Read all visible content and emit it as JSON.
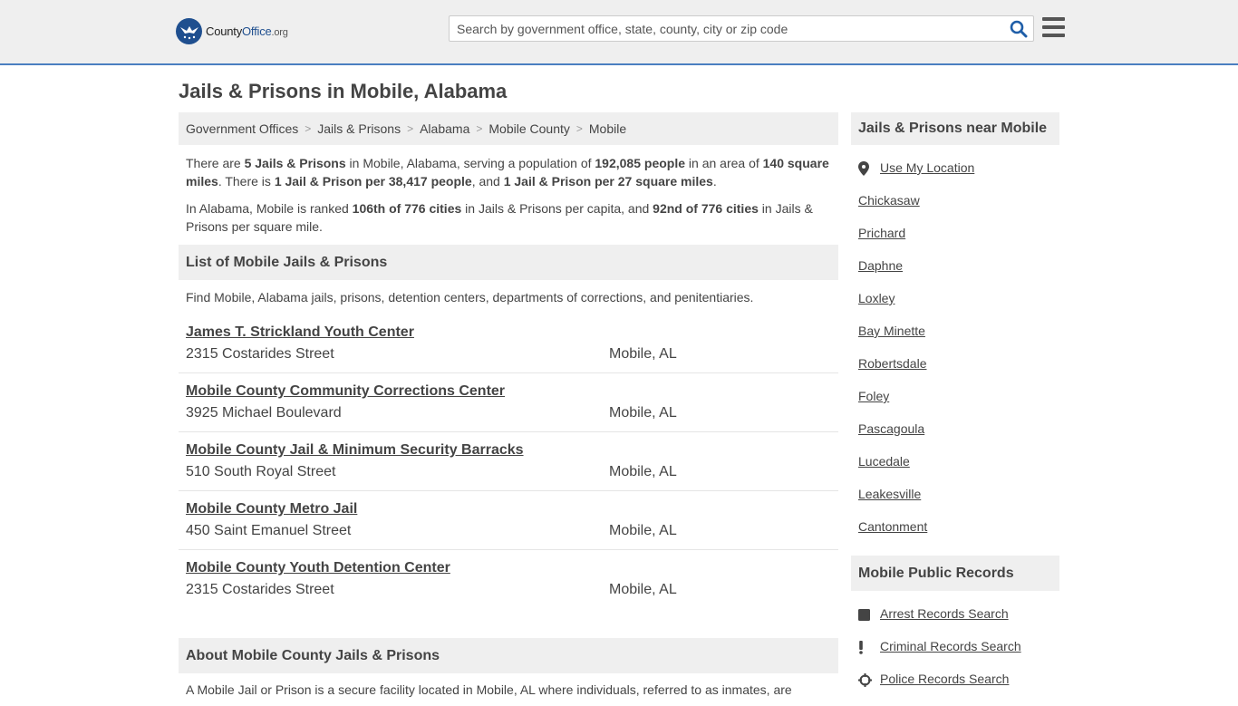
{
  "header": {
    "logo": {
      "name_part1": "County",
      "name_part2": "Office",
      "tld": ".org"
    },
    "search_placeholder": "Search by government office, state, county, city or zip code",
    "search_value": "",
    "menu_icon": "hamburger-icon",
    "search_icon": "search-icon"
  },
  "page_title": "Jails & Prisons in Mobile, Alabama",
  "breadcrumb": [
    {
      "label": "Government Offices"
    },
    {
      "label": "Jails & Prisons"
    },
    {
      "label": "Alabama"
    },
    {
      "label": "Mobile County"
    },
    {
      "label": "Mobile"
    }
  ],
  "intro": {
    "p1": {
      "t1": "There are ",
      "b1": "5 Jails & Prisons",
      "t2": " in Mobile, Alabama, serving a population of ",
      "b2": "192,085 people",
      "t3": " in an area of ",
      "b3": "140 square miles",
      "t4": ". There is ",
      "b4": "1 Jail & Prison per 38,417 people",
      "t5": ", and ",
      "b5": "1 Jail & Prison per 27 square miles",
      "t6": "."
    },
    "p2": {
      "t1": "In Alabama, Mobile is ranked ",
      "b1": "106th of 776 cities",
      "t2": " in Jails & Prisons per capita, and ",
      "b2": "92nd of 776 cities",
      "t3": " in Jails & Prisons per square mile."
    }
  },
  "list_section": {
    "title": "List of Mobile Jails & Prisons",
    "subtitle": "Find Mobile, Alabama jails, prisons, detention centers, departments of corrections, and penitentiaries.",
    "items": [
      {
        "name": "James T. Strickland Youth Center",
        "address": "2315 Costarides Street",
        "city": "Mobile, AL"
      },
      {
        "name": "Mobile County Community Corrections Center",
        "address": "3925 Michael Boulevard",
        "city": "Mobile, AL"
      },
      {
        "name": "Mobile County Jail & Minimum Security Barracks",
        "address": "510 South Royal Street",
        "city": "Mobile, AL"
      },
      {
        "name": "Mobile County Metro Jail",
        "address": "450 Saint Emanuel Street",
        "city": "Mobile, AL"
      },
      {
        "name": "Mobile County Youth Detention Center",
        "address": "2315 Costarides Street",
        "city": "Mobile, AL"
      }
    ]
  },
  "about_section": {
    "title": "About Mobile County Jails & Prisons",
    "text": "A Mobile Jail or Prison is a secure facility located in Mobile, AL where individuals, referred to as inmates, are"
  },
  "sidebar": {
    "nearby": {
      "title": "Jails & Prisons near Mobile",
      "use_location": "Use My Location",
      "cities": [
        "Chickasaw",
        "Prichard",
        "Daphne",
        "Loxley",
        "Bay Minette",
        "Robertsdale",
        "Foley",
        "Pascagoula",
        "Lucedale",
        "Leakesville",
        "Cantonment"
      ]
    },
    "records": {
      "title": "Mobile Public Records",
      "items": [
        {
          "label": "Arrest Records Search",
          "icon": "square-icon"
        },
        {
          "label": "Criminal Records Search",
          "icon": "exclamation-icon"
        },
        {
          "label": "Police Records Search",
          "icon": "crosshair-icon"
        }
      ]
    }
  },
  "colors": {
    "accent_border": "#4a7fc0",
    "logo_blue": "#1f4f8f",
    "search_icon_blue": "#1f5ea8",
    "panel_gray": "#efefef",
    "text": "#444444"
  }
}
